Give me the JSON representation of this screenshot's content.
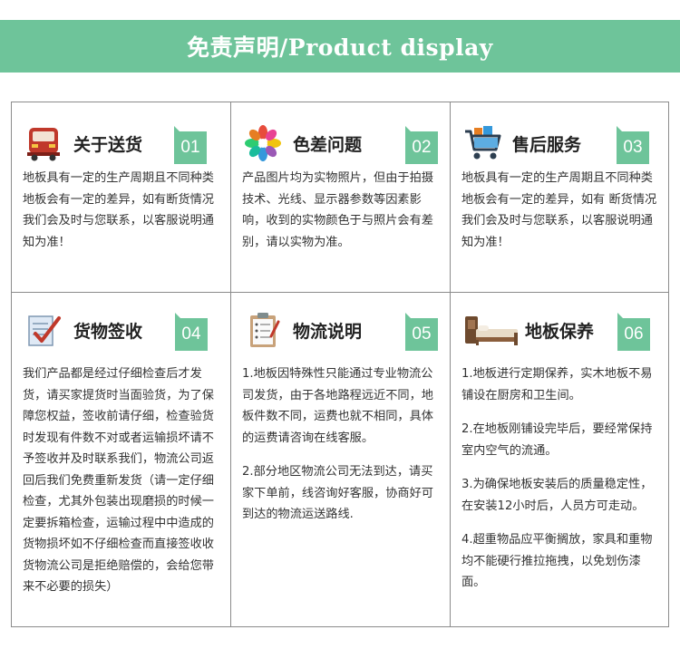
{
  "header": {
    "title": "免责声明/Product display"
  },
  "accent_color": "#6ec49a",
  "cells": [
    {
      "title": "关于送货",
      "number": "01",
      "icon": "delivery-truck-icon",
      "paragraphs": [
        "地板具有一定的生产周期且不同种类地板会有一定的差异，如有断货情况我们会及时与您联系，以客服说明通知为准！"
      ]
    },
    {
      "title": "色差问题",
      "number": "02",
      "icon": "color-wheel-icon",
      "paragraphs": [
        "产品图片均为实物照片，但由于拍摄技术、光线、显示器参数等因素影响，收到的实物颜色于与照片会有差别，请以实物为准。"
      ]
    },
    {
      "title": "售后服务",
      "number": "03",
      "icon": "shopping-cart-icon",
      "paragraphs": [
        "地板具有一定的生产周期且不同种类地板会有一定的差异，如有 断货情况我们会及时与您联系，以客服说明通知为准！"
      ]
    },
    {
      "title": "货物签收",
      "number": "04",
      "icon": "checklist-icon",
      "paragraphs": [
        "我们产品都是经过仔细检查后才发货，请买家提货时当面验货，为了保障您权益，签收前请仔细，检查验货时发现有件数不对或者运输损坏请不予签收并及时联系我们，物流公司返回后我们免费重新发货（请一定仔细检查，尤其外包装出现磨损的时候一定要拆箱检查，运输过程中中造成的货物损坏如不仔细检查而直接签收收货物流公司是拒绝赔偿的，会给您带来不必要的损失）"
      ]
    },
    {
      "title": "物流说明",
      "number": "05",
      "icon": "clipboard-icon",
      "paragraphs": [
        "1.地板因特殊性只能通过专业物流公司发货，由于各地路程远近不同，地板件数不同，运费也就不相同，具体的运费请咨询在线客服。",
        "2.部分地区物流公司无法到达，请买家下单前，线咨询好客服，协商好可到达的物流运送路线."
      ]
    },
    {
      "title": "地板保养",
      "number": "06",
      "icon": "bed-icon",
      "paragraphs": [
        "1.地板进行定期保养，实木地板不易铺设在厨房和卫生间。",
        "2.在地板刚铺设完毕后，要经常保持室内空气的流通。",
        "3.为确保地板安装后的质量稳定性，在安装12小时后，人员方可走动。",
        "4.超重物品应平衡搁放，家具和重物均不能硬行推拉拖拽，以免划伤漆面。"
      ]
    }
  ]
}
